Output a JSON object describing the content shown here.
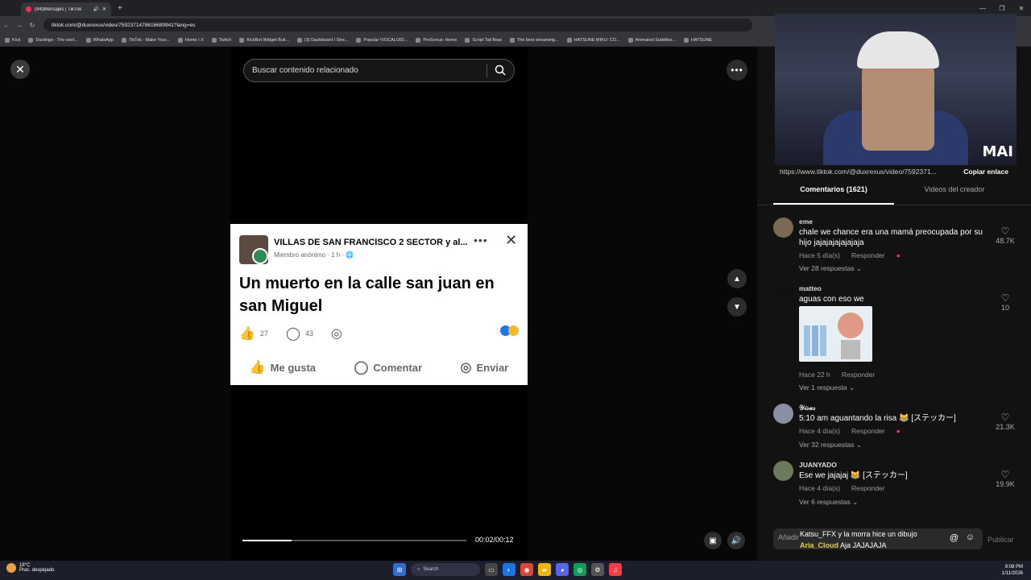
{
  "browser": {
    "tab_title": "(94)Mensajes | TikTok",
    "url": "tiktok.com/@duxrexus/video/7592371478616689941?lang=es",
    "bookmarks": [
      "Kick",
      "Duolingo - The worl...",
      "WhatsApp",
      "TikTok - Make Your...",
      "Home / X",
      "Twitch",
      "KickBot Widget Buil...",
      "(3) Dashboard / Stre...",
      "Popular !VOCALOID...",
      "PreSonus: Home",
      "Script Tail Beat",
      "The best streaming...",
      "HATSUNE MIKU: CO...",
      "Animated Subtitles...",
      "HATSUNE"
    ]
  },
  "player": {
    "search_placeholder": "Buscar contenido relacionado",
    "time": "00:02/00:12",
    "progress": 0.22
  },
  "post": {
    "group": "VILLAS DE SAN FRANCISCO 2 SECTOR y al...",
    "meta": "Miembro anónimo · 1 h · ",
    "text": "Un muerto en la calle san juan en san Miguel",
    "likes": "27",
    "comments": "43",
    "like_label": "Me gusta",
    "comment_label": "Comentar",
    "send_label": "Enviar"
  },
  "side": {
    "link": "https://www.tiktok.com/@duxrexus/video/7592371...",
    "copy_label": "Copiar enlace",
    "cam_logo": "MAI",
    "tab_comments": "Comentarios (1621)",
    "tab_videos": "Videos del creador",
    "comments": [
      {
        "name": "eme",
        "text": "chale we chance era una mamá preocupada por su hijo jajajajajajajaja",
        "time": "Hace 5 día(s)",
        "reply": "Responder",
        "replies": "Ver 28 respuestas",
        "likes": "48.7K"
      },
      {
        "name": "matteo",
        "text": "aguas con eso we",
        "time": "Hace 22 h",
        "reply": "Responder",
        "replies": "Ver 1 respuesta",
        "likes": "10"
      },
      {
        "name": "𝒴𝒾𝓈𝓊𝓈",
        "text": "5:10 am aguantando la risa 😹 [ステッカー]",
        "time": "Hace 4 día(s)",
        "reply": "Responder",
        "replies": "Ver 32 respuestas",
        "likes": "21.3K"
      },
      {
        "name": "JUANYADO",
        "text": "Ese we jajajaj 😹 [ステッカー]",
        "time": "Hace 4 día(s)",
        "reply": "Responder",
        "replies": "Ver 6 respuestas",
        "likes": "19.9K"
      }
    ],
    "input_placeholder": "Añadir",
    "overlay_line1": "Katsu_FFX  y la morra hice un dibujo",
    "overlay_user": "Aria_Cloud",
    "overlay_msg": "Aja JAJAJAJA",
    "publish": "Publicar"
  },
  "taskbar": {
    "temp": "18°C",
    "weather": "Prac. despejado",
    "search": "Search",
    "time": "9:08 PM",
    "date": "1/11/2026"
  },
  "colors": {
    "accent": "#fe2c55",
    "fb_blue": "#1877f2"
  }
}
